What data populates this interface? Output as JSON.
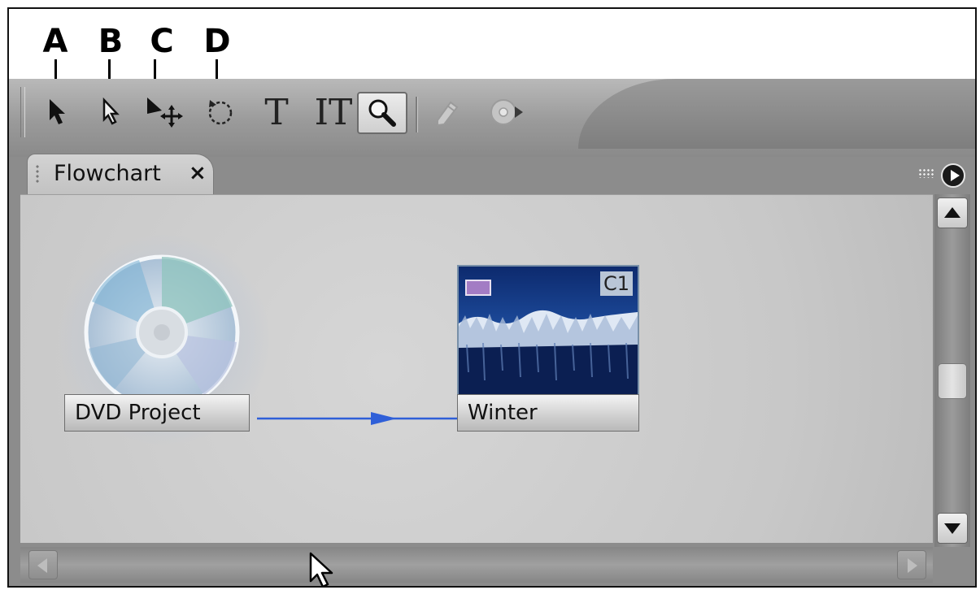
{
  "callouts": {
    "a": "A",
    "b": "B",
    "c": "C",
    "d": "D"
  },
  "toolbar": {
    "tools": [
      {
        "name": "selection-tool",
        "icon": "arrow-pointer-icon"
      },
      {
        "name": "direct-select-tool",
        "icon": "hollow-arrow-pointer-icon"
      },
      {
        "name": "move-tool",
        "icon": "arrow-move-icon"
      },
      {
        "name": "rotate-tool",
        "icon": "rotate-dashed-icon"
      },
      {
        "name": "text-tool",
        "label": "T"
      },
      {
        "name": "vertical-text-tool",
        "label": "IT"
      },
      {
        "name": "zoom-tool",
        "icon": "magnifier-icon",
        "selected": true
      },
      {
        "name": "pencil-tool",
        "icon": "pencil-icon",
        "disabled": true
      },
      {
        "name": "preview-tool",
        "icon": "disc-play-icon",
        "disabled": true
      }
    ],
    "text_tool_label": "T",
    "vertical_text_tool_label": "IT"
  },
  "panel": {
    "tab_label": "Flowchart",
    "tab_close": "×"
  },
  "flowchart": {
    "project_node_label": "DVD Project",
    "timeline_node_label": "Winter",
    "timeline_badge": "C1",
    "connector_color": "#2f5fd8"
  },
  "colors": {
    "accent_blue": "#2f5fd8",
    "thumbnail_dark": "#0a1a4a"
  }
}
